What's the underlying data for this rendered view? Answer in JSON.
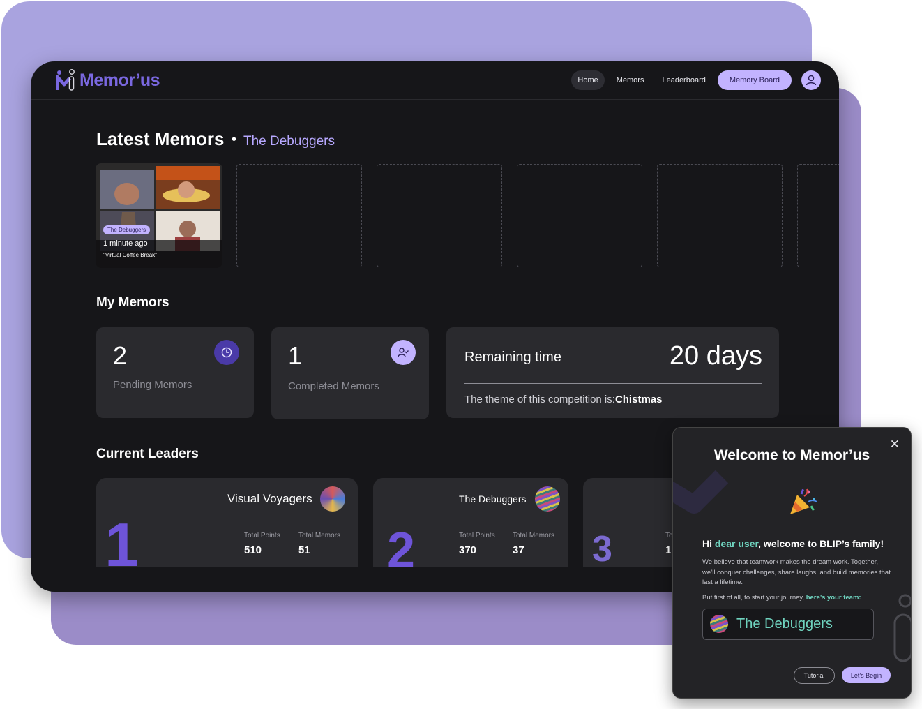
{
  "app": {
    "logo_text": "Memor’us",
    "nav": {
      "home": "Home",
      "memors": "Memors",
      "leaderboard": "Leaderboard",
      "memory_board": "Memory Board"
    }
  },
  "latest": {
    "title": "Latest Memors",
    "separator": "•",
    "team": "The Debuggers",
    "card": {
      "team_badge": "The Debuggers",
      "time": "1 minute ago",
      "caption": "\"Virtual Coffee Break\""
    }
  },
  "my_memors": {
    "title": "My Memors",
    "pending": {
      "count": "2",
      "label": "Pending Memors"
    },
    "completed": {
      "count": "1",
      "label": "Completed Memors"
    },
    "remaining": {
      "label": "Remaining time",
      "value": "20 days",
      "theme_prefix": "The theme of this competition is:",
      "theme": "Chistmas"
    }
  },
  "leaders": {
    "title": "Current Leaders",
    "items": [
      {
        "rank": "1",
        "name": "Visual Voyagers",
        "points_label": "Total Points",
        "points": "510",
        "memors_label": "Total Memors",
        "memors": "51"
      },
      {
        "rank": "2",
        "name": "The Debuggers",
        "points_label": "Total Points",
        "points": "370",
        "memors_label": "Total Memors",
        "memors": "37"
      },
      {
        "rank": "3",
        "points_label_partial": "To",
        "points_partial": "1"
      }
    ]
  },
  "modal": {
    "title": "Welcome to Memor’us",
    "greeting_pre": "Hi ",
    "greeting_user": "dear user",
    "greeting_post": ", welcome to BLIP’s family!",
    "body": "We believe that teamwork makes the dream work. Together, we’ll conquer challenges, share laughs, and build memories that last a lifetime.",
    "journey_pre": "But first of all, to start your journey, ",
    "journey_highlight": "here’s your team:",
    "team_name": "The Debuggers",
    "tutorial_label": "Tutorial",
    "begin_label": "Let’s Begin",
    "close_glyph": "✕"
  },
  "colors": {
    "accent": "#c2b3ff",
    "brand": "#7a68e0",
    "rank": "#6e54d9",
    "team_highlight": "#6fd3bf"
  }
}
